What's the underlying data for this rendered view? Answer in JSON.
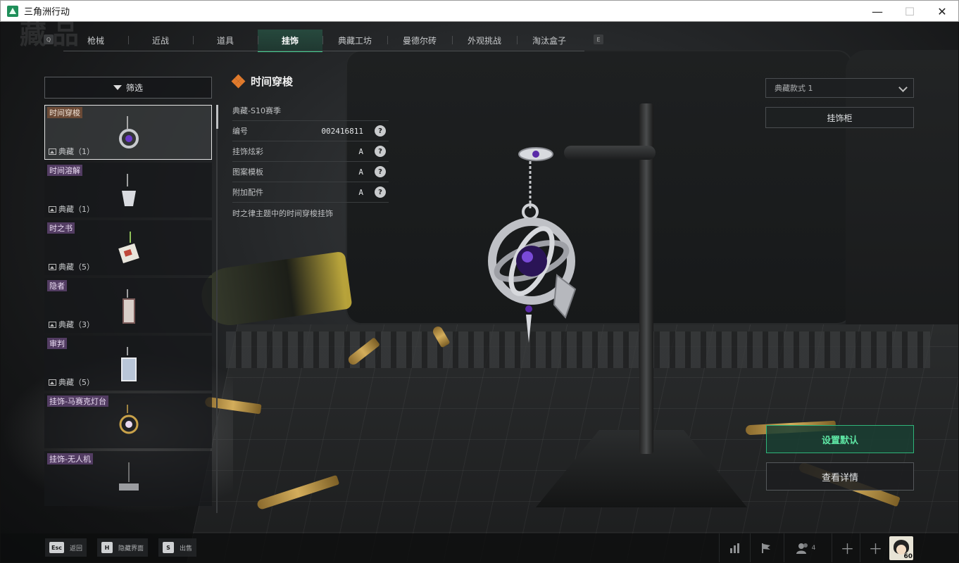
{
  "window": {
    "title": "三角洲行动",
    "controls": {
      "minimize": "—",
      "maximize": "☐",
      "close": "✕"
    }
  },
  "nav": {
    "prev_key": "Q",
    "next_key": "E",
    "tabs": [
      {
        "label": "枪械",
        "active": false
      },
      {
        "label": "近战",
        "active": false
      },
      {
        "label": "道具",
        "active": false
      },
      {
        "label": "挂饰",
        "active": true
      },
      {
        "label": "典藏工坊",
        "active": false
      },
      {
        "label": "曼德尔砖",
        "active": false
      },
      {
        "label": "外观挑战",
        "active": false
      },
      {
        "label": "淘汰盒子",
        "active": false
      }
    ]
  },
  "filter": {
    "label": "筛选"
  },
  "list": [
    {
      "name": "时间穿梭",
      "count": "典藏（1）",
      "selected": true
    },
    {
      "name": "时间溶解",
      "count": "典藏（1）",
      "selected": false
    },
    {
      "name": "时之书",
      "count": "典藏（5）",
      "selected": false
    },
    {
      "name": "隐者",
      "count": "典藏（3）",
      "selected": false
    },
    {
      "name": "审判",
      "count": "典藏（5）",
      "selected": false
    },
    {
      "name": "挂饰-马赛克灯台",
      "count": "",
      "selected": false
    },
    {
      "name": "挂饰-无人机",
      "count": "",
      "selected": false
    }
  ],
  "detail": {
    "title": "时间穿梭",
    "season": "典藏-S10赛季",
    "rows": [
      {
        "label": "编号",
        "value": "002416811",
        "help": "?"
      },
      {
        "label": "挂饰炫彩",
        "value": "A",
        "help": "?"
      },
      {
        "label": "图案模板",
        "value": "A",
        "help": "?"
      },
      {
        "label": "附加配件",
        "value": "A",
        "help": "?"
      }
    ],
    "description": "时之律主题中的时间穿梭挂饰"
  },
  "right": {
    "style_select": "典藏款式 1",
    "cabinet_button": "挂饰柜",
    "default_button": "设置默认",
    "details_button": "查看详情"
  },
  "footer": {
    "hints": [
      {
        "key": "Esc",
        "label": "返回"
      },
      {
        "key": "H",
        "label": "隐藏界面"
      },
      {
        "key": "S",
        "label": "出售"
      }
    ],
    "friends_count": "4",
    "avatar_level": "60"
  },
  "colors": {
    "accent_green": "#3bd08d",
    "default_button_text": "#5ee6a4",
    "legendary_tag": "#523c62",
    "selected_tag": "#6b4a36"
  }
}
